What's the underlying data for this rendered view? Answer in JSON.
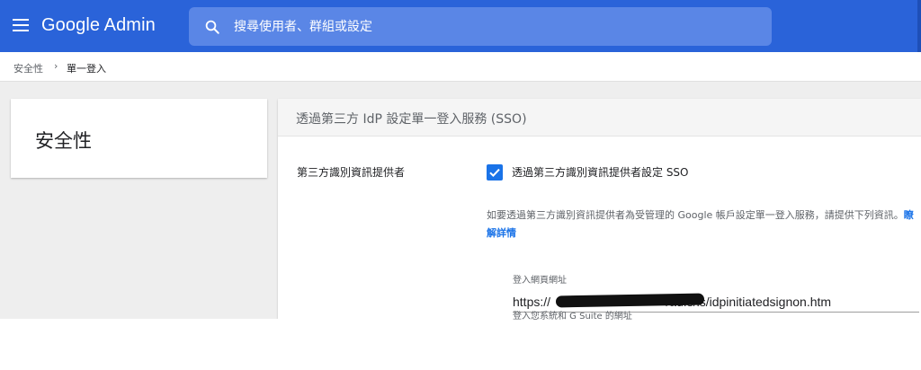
{
  "header": {
    "app_name": "Google Admin",
    "search_placeholder": "搜尋使用者、群組或設定",
    "accent_color": "#2a63d9",
    "menu_icon": "hamburger-menu-icon",
    "search_icon": "search-icon"
  },
  "breadcrumb": {
    "parent": "安全性",
    "separator": "›",
    "current": "單一登入"
  },
  "left_card": {
    "title": "安全性"
  },
  "panel": {
    "title": "透過第三方 IdP 設定單一登入服務 (SSO)",
    "setting_label": "第三方識別資訊提供者",
    "checkbox_checked": true,
    "checkbox_label": "透過第三方識別資訊提供者設定 SSO",
    "description": "如要透過第三方識別資訊提供者為受管理的 Google 帳戶設定單一登入服務，請提供下列資訊。",
    "learn_more": "瞭解詳情",
    "sign_in_label": "登入網頁網址",
    "sign_in_url": "https://                                 /adfs/ls/idpinitiatedsignon.htm",
    "next_field_label": "登入您系統和 G Suite 的網址"
  }
}
